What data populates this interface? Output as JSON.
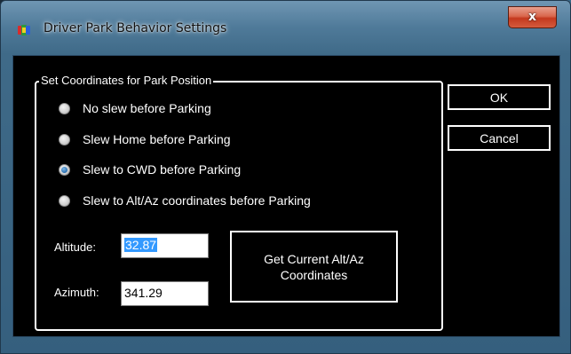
{
  "window": {
    "title": "Driver Park Behavior Settings",
    "close_label": "x",
    "icon": "telescope-app-icon"
  },
  "group": {
    "title": "Set Coordinates for Park Position",
    "options": [
      {
        "label": "No slew before Parking",
        "checked": false
      },
      {
        "label": "Slew Home before Parking",
        "checked": false
      },
      {
        "label": "Slew to CWD before Parking",
        "checked": true
      },
      {
        "label": "Slew to Alt/Az coordinates before Parking",
        "checked": false
      }
    ],
    "altitude_label": "Altitude:",
    "altitude_value": "32.87",
    "azimuth_label": "Azimuth:",
    "azimuth_value": "341.29",
    "get_coords_label": "Get Current Alt/Az Coordinates"
  },
  "buttons": {
    "ok_label": "OK",
    "cancel_label": "Cancel"
  },
  "colors": {
    "client_bg": "#000000",
    "selection": "#3399ff",
    "close_red": "#c4391e"
  }
}
